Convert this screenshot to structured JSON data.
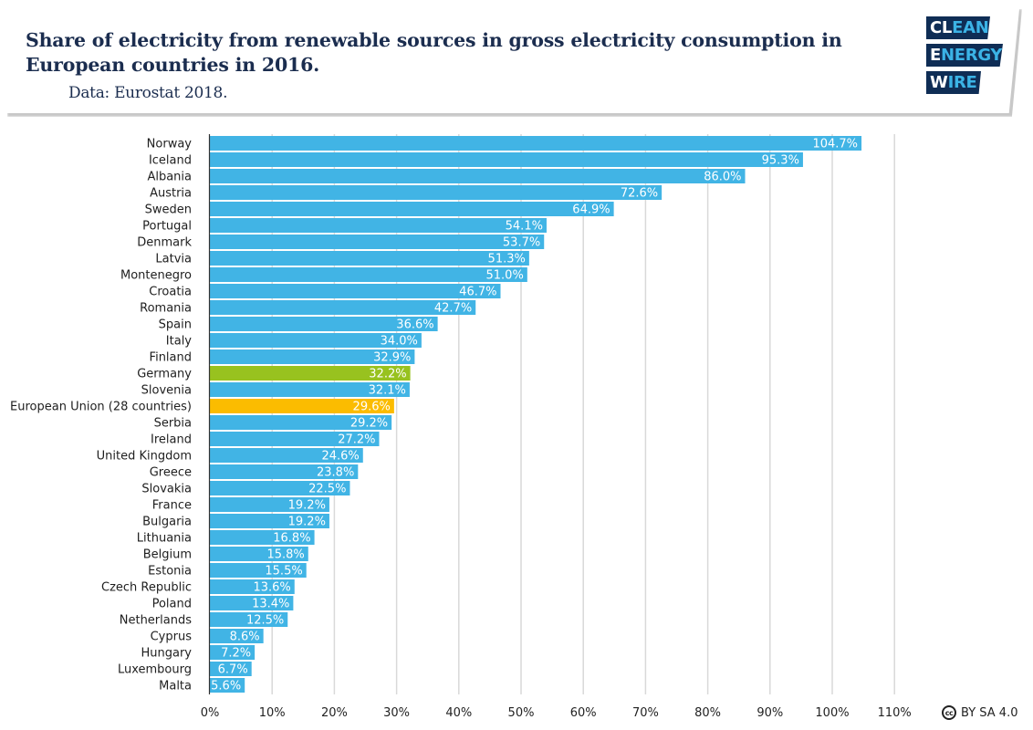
{
  "header": {
    "title": "Share of electricity from renewable sources in gross electricity consumption in European countries in 2016.",
    "subtitle": "Data: Eurostat 2018.",
    "logo": [
      {
        "white": "CL",
        "cyan": "EAN"
      },
      {
        "white": "E",
        "cyan": "NERGY"
      },
      {
        "white": "W",
        "cyan": "IRE"
      }
    ]
  },
  "license": {
    "icon": "cc-icon",
    "icon_text": "cc",
    "text": "BY SA 4.0"
  },
  "colors": {
    "default_bar": "#41b4e5",
    "highlight_germany": "#98c21f",
    "highlight_eu": "#fbbc00",
    "grid": "#d9d9d9",
    "axis": "#333333",
    "title": "#1b2d4f",
    "logo_bg": "#0f2d55",
    "logo_accent": "#3bb3e6"
  },
  "chart_data": {
    "type": "bar",
    "orientation": "horizontal",
    "title": "Share of electricity from renewable sources in gross electricity consumption in European countries in 2016.",
    "xlabel": "",
    "ylabel": "",
    "xlim": [
      0,
      110
    ],
    "x_ticks": [
      "0%",
      "10%",
      "20%",
      "30%",
      "40%",
      "50%",
      "60%",
      "70%",
      "80%",
      "90%",
      "100%",
      "110%"
    ],
    "grid": "vertical",
    "legend": "none",
    "categories": [
      "Norway",
      "Iceland",
      "Albania",
      "Austria",
      "Sweden",
      "Portugal",
      "Denmark",
      "Latvia",
      "Montenegro",
      "Croatia",
      "Romania",
      "Spain",
      "Italy",
      "Finland",
      "Germany",
      "Slovenia",
      "European Union (28 countries)",
      "Serbia",
      "Ireland",
      "United Kingdom",
      "Greece",
      "Slovakia",
      "France",
      "Bulgaria",
      "Lithuania",
      "Belgium",
      "Estonia",
      "Czech Republic",
      "Poland",
      "Netherlands",
      "Cyprus",
      "Hungary",
      "Luxembourg",
      "Malta"
    ],
    "values": [
      104.7,
      95.3,
      86.0,
      72.6,
      64.9,
      54.1,
      53.7,
      51.3,
      51.0,
      46.7,
      42.7,
      36.6,
      34.0,
      32.9,
      32.2,
      32.1,
      29.6,
      29.2,
      27.2,
      24.6,
      23.8,
      22.5,
      19.2,
      19.2,
      16.8,
      15.8,
      15.5,
      13.6,
      13.4,
      12.5,
      8.6,
      7.2,
      6.7,
      5.6
    ],
    "labels": [
      "104.7%",
      "95.3%",
      "86.0%",
      "72.6%",
      "64.9%",
      "54.1%",
      "53.7%",
      "51.3%",
      "51.0%",
      "46.7%",
      "42.7%",
      "36.6%",
      "34.0%",
      "32.9%",
      "32.2%",
      "32.1%",
      "29.6%",
      "29.2%",
      "27.2%",
      "24.6%",
      "23.8%",
      "22.5%",
      "19.2%",
      "19.2%",
      "16.8%",
      "15.8%",
      "15.5%",
      "13.6%",
      "13.4%",
      "12.5%",
      "8.6%",
      "7.2%",
      "6.7%",
      "5.6%"
    ],
    "highlights": {
      "Germany": "#98c21f",
      "European Union (28 countries)": "#fbbc00"
    }
  }
}
